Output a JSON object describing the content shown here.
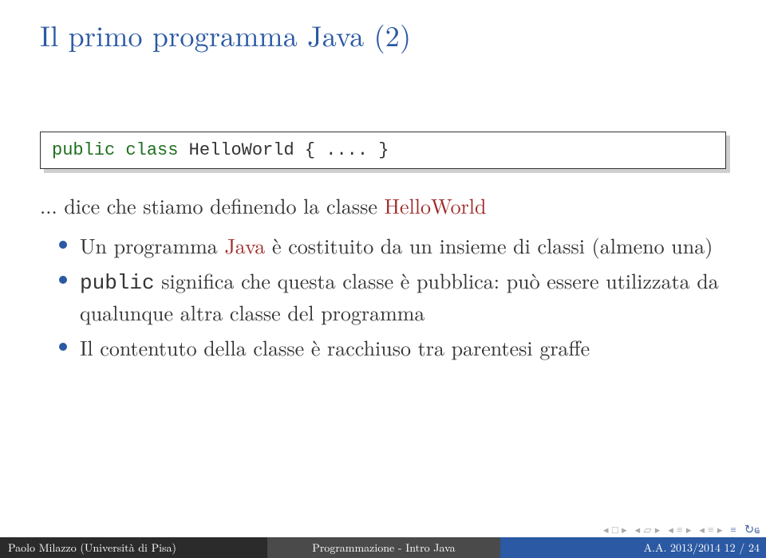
{
  "title": "Il primo programma Java (2)",
  "code": {
    "kw_public": "public",
    "kw_class": "class",
    "rest": " HelloWorld {",
    "ellipsis": " .... }"
  },
  "intro": {
    "ellipsis": "... ",
    "part1": "dice che stiamo definendo la classe ",
    "classname": "HelloWorld"
  },
  "bullets": [
    {
      "pre": "Un programma ",
      "brand": "Java",
      "post": " è costituito da un insieme di classi (almeno una)"
    },
    {
      "tt": "public",
      "post": " significa che questa classe è pubblica: può essere utilizzata da qualunque altra classe del programma"
    },
    {
      "text": "Il contentuto della classe è racchiuso tra parentesi graffe"
    }
  ],
  "footer": {
    "left": "Paolo Milazzo (Università di Pisa)",
    "mid": "Programmazione - Intro Java",
    "right": "A.A. 2013/2014      12 / 24"
  }
}
